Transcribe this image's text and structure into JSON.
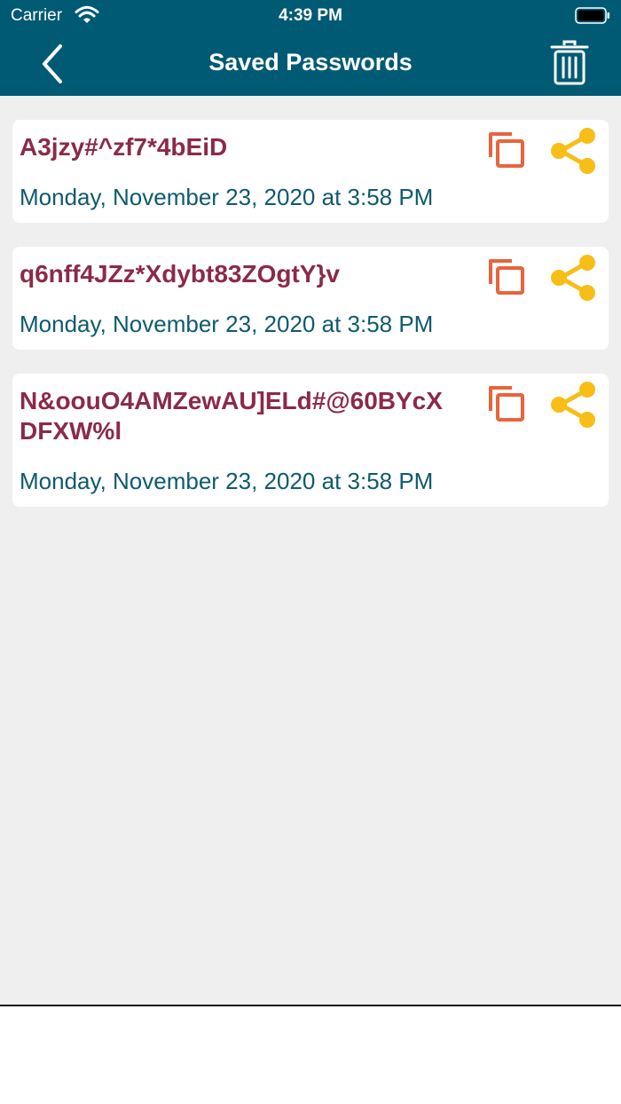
{
  "status_bar": {
    "carrier": "Carrier",
    "time": "4:39 PM"
  },
  "header": {
    "title": "Saved Passwords",
    "back_icon": "chevron-left-icon",
    "trash_icon": "trash-icon"
  },
  "colors": {
    "header_bg": "#005a73",
    "password_text": "#8b2a48",
    "timestamp_text": "#0e5a6e",
    "copy_icon": "#e8643c",
    "share_icon": "#f7be17",
    "background": "#efefef"
  },
  "passwords": [
    {
      "password": "A3jzy#^zf7*4bEiD",
      "timestamp": "Monday, November 23, 2020 at 3:58 PM"
    },
    {
      "password": "q6nff4JZz*Xdybt83ZOgtY}v",
      "timestamp": "Monday, November 23, 2020 at 3:58 PM"
    },
    {
      "password": "N&oouO4AMZewAU]ELd#@60BYcXDFXW%l",
      "timestamp": "Monday, November 23, 2020 at 3:58 PM"
    }
  ]
}
